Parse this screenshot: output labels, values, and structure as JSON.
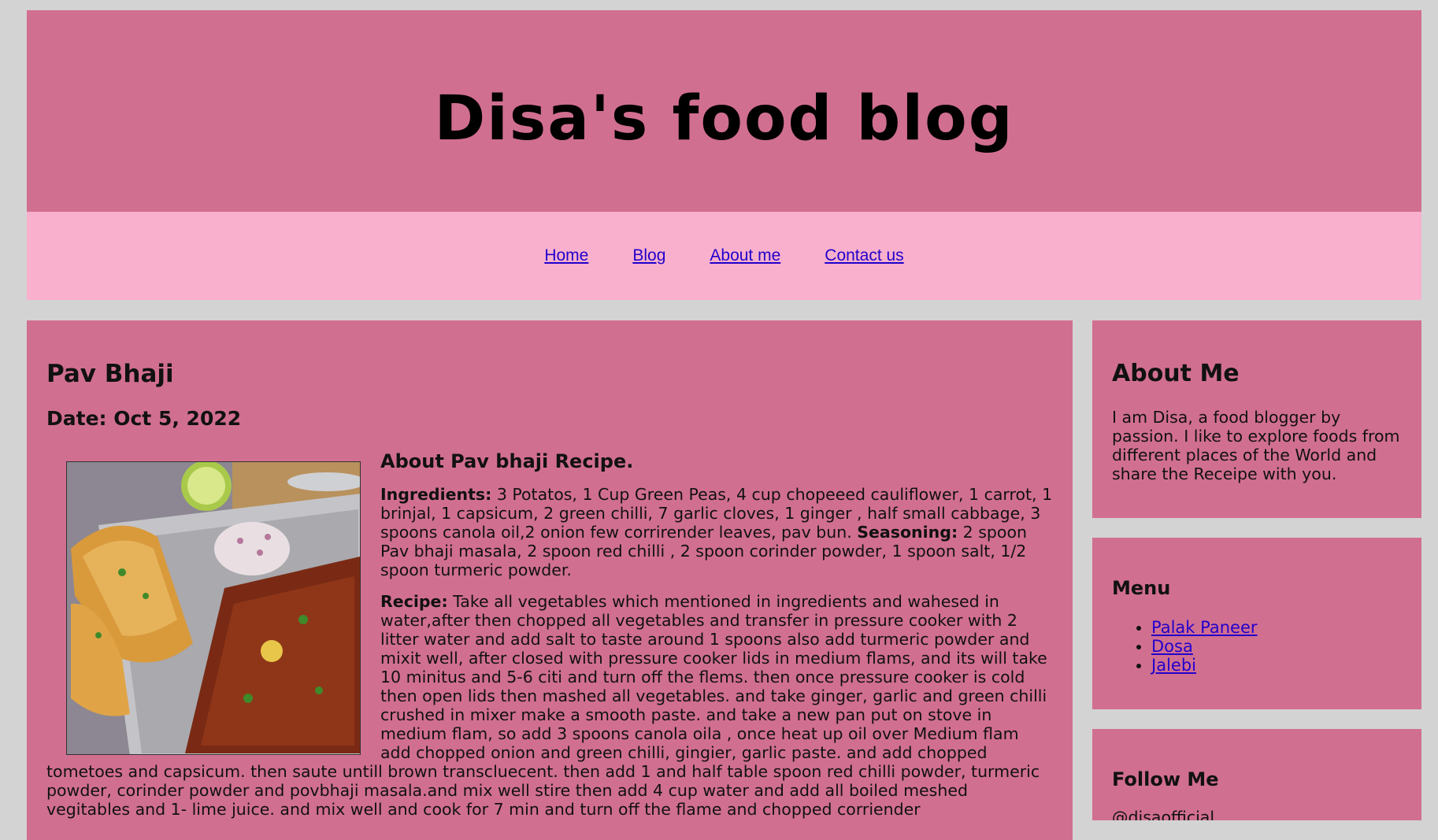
{
  "site": {
    "title": "Disa's food blog"
  },
  "nav": {
    "items": [
      "Home",
      "Blog",
      "About me",
      "Contact us"
    ]
  },
  "post": {
    "title": "Pav Bhaji",
    "date": "Date: Oct 5, 2022",
    "subtitle": "About Pav bhaji Recipe.",
    "ingredients_label": "Ingredients:",
    "ingredients_text": " 3 Potatos, 1 Cup Green Peas, 4 cup chopeeed cauliflower, 1 carrot, 1 brinjal, 1 capsicum, 2 green chilli, 7 garlic cloves, 1 ginger , half small cabbage, 3 spoons canola oil,2 onion few corrirender leaves, pav bun. ",
    "seasoning_label": "Seasoning:",
    "seasoning_text": " 2 spoon Pav bhaji masala, 2 spoon red chilli , 2 spoon corinder powder, 1 spoon salt, 1/2 spoon turmeric powder.",
    "recipe_label": "Recipe:",
    "recipe_text": " Take all vegetables which mentioned in ingredients and wahesed in water,after then chopped all vegetables and transfer in pressure cooker with 2 litter water and add salt to taste around 1 spoons also add turmeric powder and mixit well, after closed with pressure cooker lids in medium flams, and its will take 10 minitus and 5-6 citi and turn off the flems. then once pressure cooker is cold then open lids then mashed all vegetables. and take ginger, garlic and green chilli crushed in mixer make a smooth paste. and take a new pan put on stove in medium flam, so add 3 spoons canola oila , once heat up oil over Medium flam add chopped onion and green chilli, gingier, garlic paste. and add chopped tometoes and capsicum. then saute untill brown transcluecent. then add 1 and half table spoon red chilli powder, turmeric powder, corinder powder and povbhaji masala.and mix well stire then add 4 cup water and add all boiled meshed vegitables and 1- lime juice. and mix well and cook for 7 min and turn off the flame and chopped corriender"
  },
  "sidebar": {
    "about": {
      "heading": "About Me",
      "text": "I am Disa, a food blogger by passion. I like to explore foods from different places of the World and share the Receipe with you."
    },
    "menu": {
      "heading": "Menu",
      "items": [
        "Palak Paneer",
        "Dosa",
        "Jalebi"
      ]
    },
    "follow": {
      "heading": "Follow Me",
      "handle": "@disaofficial"
    }
  },
  "colors": {
    "page_bg": "#d3d3d3",
    "panel": "#d16f91",
    "nav_bg": "#f8b0cd",
    "link": "#2200cc"
  }
}
